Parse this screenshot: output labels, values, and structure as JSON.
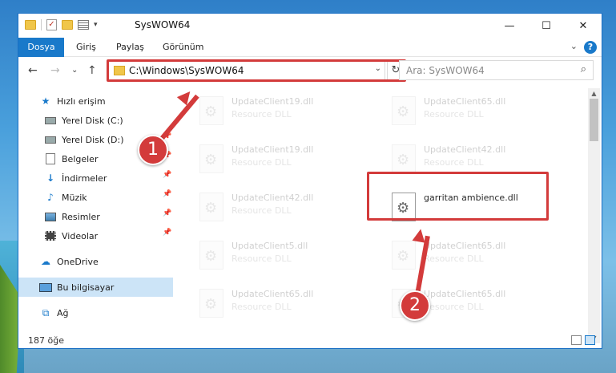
{
  "window": {
    "title": "SysWOW64",
    "controls": {
      "minimize": "—",
      "maximize": "☐",
      "close": "✕"
    }
  },
  "ribbon": {
    "tabs": [
      "Dosya",
      "Giriş",
      "Paylaş",
      "Görünüm"
    ],
    "help": "?"
  },
  "address": {
    "path": "C:\\Windows\\SysWOW64",
    "search_placeholder": "Ara: SysWOW64"
  },
  "sidebar": {
    "items": [
      {
        "label": "Hızlı erişim",
        "icon": "star-icon",
        "pinned": false
      },
      {
        "label": "Yerel Disk (C:)",
        "icon": "disk-icon",
        "pinned": true
      },
      {
        "label": "Yerel Disk (D:)",
        "icon": "disk-icon",
        "pinned": true
      },
      {
        "label": "Belgeler",
        "icon": "documents-icon",
        "pinned": true
      },
      {
        "label": "İndirmeler",
        "icon": "downloads-icon",
        "pinned": true
      },
      {
        "label": "Müzik",
        "icon": "music-icon",
        "pinned": true
      },
      {
        "label": "Resimler",
        "icon": "pictures-icon",
        "pinned": true
      },
      {
        "label": "Videolar",
        "icon": "videos-icon",
        "pinned": true
      },
      {
        "label": "OneDrive",
        "icon": "cloud-icon",
        "pinned": false
      },
      {
        "label": "Bu bilgisayar",
        "icon": "computer-icon",
        "pinned": false
      },
      {
        "label": "Ağ",
        "icon": "network-icon",
        "pinned": false
      }
    ]
  },
  "files": [
    {
      "name": "UpdateClient19.dll",
      "type": "Resource DLL"
    },
    {
      "name": "UpdateClient65.dll",
      "type": "Resource DLL"
    },
    {
      "name": "UpdateClient19.dll",
      "type": "Resource DLL"
    },
    {
      "name": "UpdateClient42.dll",
      "type": "Resource DLL"
    },
    {
      "name": "UpdateClient42.dll",
      "type": "Resource DLL"
    },
    {
      "name": "garritan ambience.dll",
      "type": ""
    },
    {
      "name": "UpdateClient5.dll",
      "type": "Resource DLL"
    },
    {
      "name": "UpdateClient65.dll",
      "type": "Resource DLL"
    },
    {
      "name": "UpdateClient65.dll",
      "type": "Resource DLL"
    },
    {
      "name": "UpdateClient65.dll",
      "type": "Resource DLL"
    }
  ],
  "status": {
    "item_count": "187 öğe"
  },
  "callouts": {
    "one": "1",
    "two": "2"
  },
  "colors": {
    "accent": "#1979ca",
    "highlight": "#d33b3b",
    "selected": "#cce4f7"
  }
}
